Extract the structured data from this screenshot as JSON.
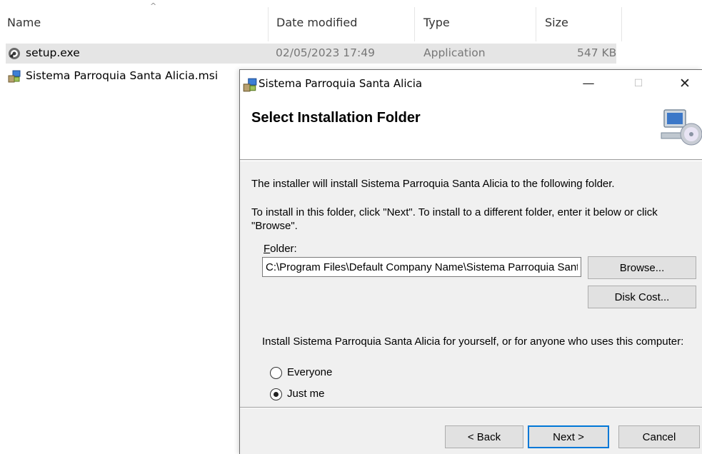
{
  "explorer": {
    "columns": {
      "name": "Name",
      "date": "Date modified",
      "type": "Type",
      "size": "Size"
    },
    "files": [
      {
        "name": "setup.exe",
        "date": "02/05/2023 17:49",
        "type": "Application",
        "size": "547 KB",
        "icon": "setup-exe-icon"
      },
      {
        "name": "Sistema Parroquia Santa Alicia.msi",
        "icon": "msi-installer-icon"
      }
    ]
  },
  "dialog": {
    "title": "Sistema Parroquia Santa Alicia",
    "heading": "Select Installation Folder",
    "intro": "The installer will install Sistema Parroquia Santa Alicia to the following folder.",
    "instructions": "To install in this folder, click \"Next\". To install to a different folder, enter it below or click \"Browse\".",
    "folder_label_accel": "F",
    "folder_label_rest": "older:",
    "folder_value": "C:\\Program Files\\Default Company Name\\Sistema Parroquia Santa Alicia\\",
    "browse_label": "Browse...",
    "disk_cost_label": "Disk Cost...",
    "install_for": "Install Sistema Parroquia Santa Alicia for yourself, or for anyone who uses this computer:",
    "option_everyone": "Everyone",
    "option_just_me": "Just me",
    "selected_option": "Just me",
    "back_label": "< Back",
    "next_label": "Next >",
    "cancel_label": "Cancel"
  },
  "colors": {
    "selection": "#e5e5e5",
    "dialog_bg": "#f0f0f0",
    "accent": "#0078d7"
  }
}
